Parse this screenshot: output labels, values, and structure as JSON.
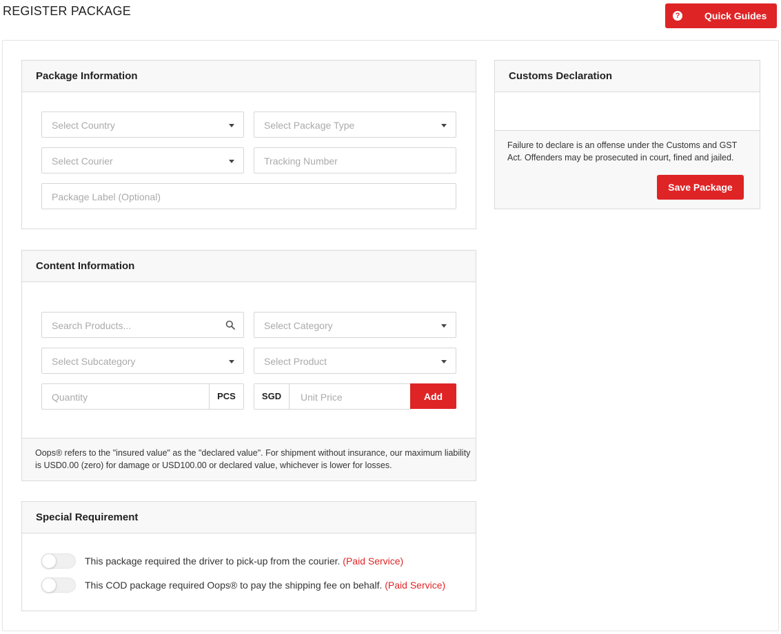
{
  "header": {
    "title": "REGISTER PACKAGE",
    "quick_guides_label": "Quick Guides",
    "quick_guides_icon": "?"
  },
  "package_info": {
    "title": "Package Information",
    "country_placeholder": "Select Country",
    "package_type_placeholder": "Select Package Type",
    "courier_placeholder": "Select Courier",
    "tracking_placeholder": "Tracking Number",
    "label_placeholder": "Package Label (Optional)"
  },
  "content_info": {
    "title": "Content Information",
    "search_placeholder": "Search Products...",
    "category_placeholder": "Select Category",
    "subcategory_placeholder": "Select Subcategory",
    "product_placeholder": "Select Product",
    "quantity_placeholder": "Quantity",
    "quantity_unit": "PCS",
    "currency": "SGD",
    "unit_price_placeholder": "Unit Price",
    "add_label": "Add",
    "note": "Oops® refers to the \"insured value\" as the \"declared value\". For shipment without insurance, our maximum liability is USD0.00 (zero) for damage or USD100.00 or declared value, whichever is lower for losses."
  },
  "special_requirement": {
    "title": "Special Requirement",
    "options": [
      {
        "text": "This package required the driver to pick-up from the courier.",
        "tag": "(Paid Service)",
        "enabled": false
      },
      {
        "text": "This COD package required Oops® to pay the shipping fee on behalf.",
        "tag": "(Paid Service)",
        "enabled": false
      }
    ]
  },
  "customs": {
    "title": "Customs Declaration",
    "note": "Failure to declare is an offense under the Customs and GST Act. Offenders may be prosecuted in court, fined and jailed.",
    "save_label": "Save Package"
  },
  "colors": {
    "accent": "#df2426",
    "panel_header_bg": "#f8f8f8",
    "border": "#dadada"
  }
}
